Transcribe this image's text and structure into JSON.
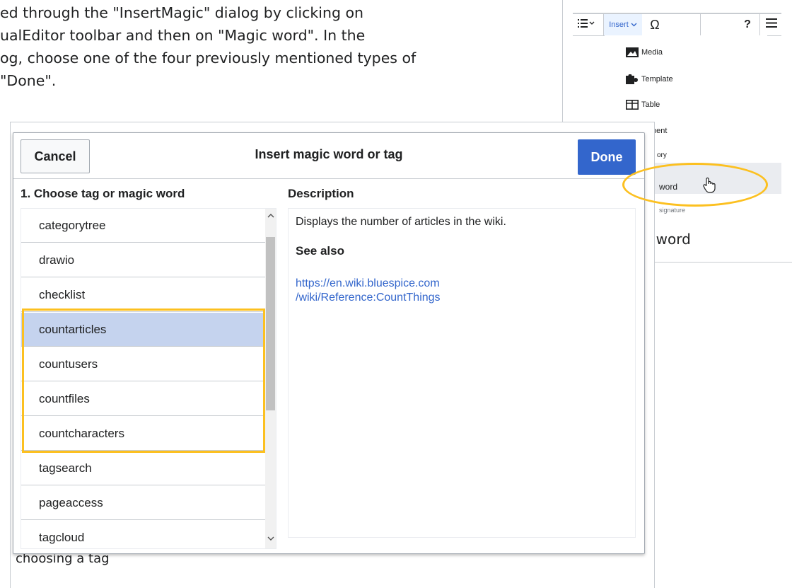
{
  "article": {
    "line1": "ed through the \"InsertMagic\" dialog by clicking on",
    "line2": "ualEditor toolbar and then on \"Magic word\". In the",
    "line3": "og, choose one of the four previously mentioned types of",
    "line4": " \"Done\"."
  },
  "thumb_main": {
    "caption": "choosing a tag"
  },
  "dialog": {
    "cancel_label": "Cancel",
    "title": "Insert magic word or tag",
    "done_label": "Done",
    "list_heading": "1. Choose tag or magic word",
    "desc_heading": "Description",
    "items": [
      {
        "label": "categorytree",
        "selected": false
      },
      {
        "label": "drawio",
        "selected": false
      },
      {
        "label": "checklist",
        "selected": false
      },
      {
        "label": "countarticles",
        "selected": true
      },
      {
        "label": "countusers",
        "selected": false
      },
      {
        "label": "countfiles",
        "selected": false
      },
      {
        "label": "countcharacters",
        "selected": false
      },
      {
        "label": "tagsearch",
        "selected": false
      },
      {
        "label": "pageaccess",
        "selected": false
      },
      {
        "label": "tagcloud",
        "selected": false
      }
    ],
    "description": {
      "text": "Displays the number of articles in the wiki.",
      "see_also": "See also",
      "link_line1": "https://en.wiki.bluespice.com",
      "link_line2": "/wiki/Reference:CountThings"
    }
  },
  "thumb_menu": {
    "insert_label": "Insert",
    "special_char": "Ω",
    "help": "?",
    "items": [
      "Media",
      "Template",
      "Table",
      "ment",
      "ory",
      "word",
      "signature"
    ],
    "caption": "gic word"
  },
  "colors": {
    "accent": "#3366cc",
    "highlight": "#fcc020",
    "selected_row": "#c5d3ee"
  }
}
